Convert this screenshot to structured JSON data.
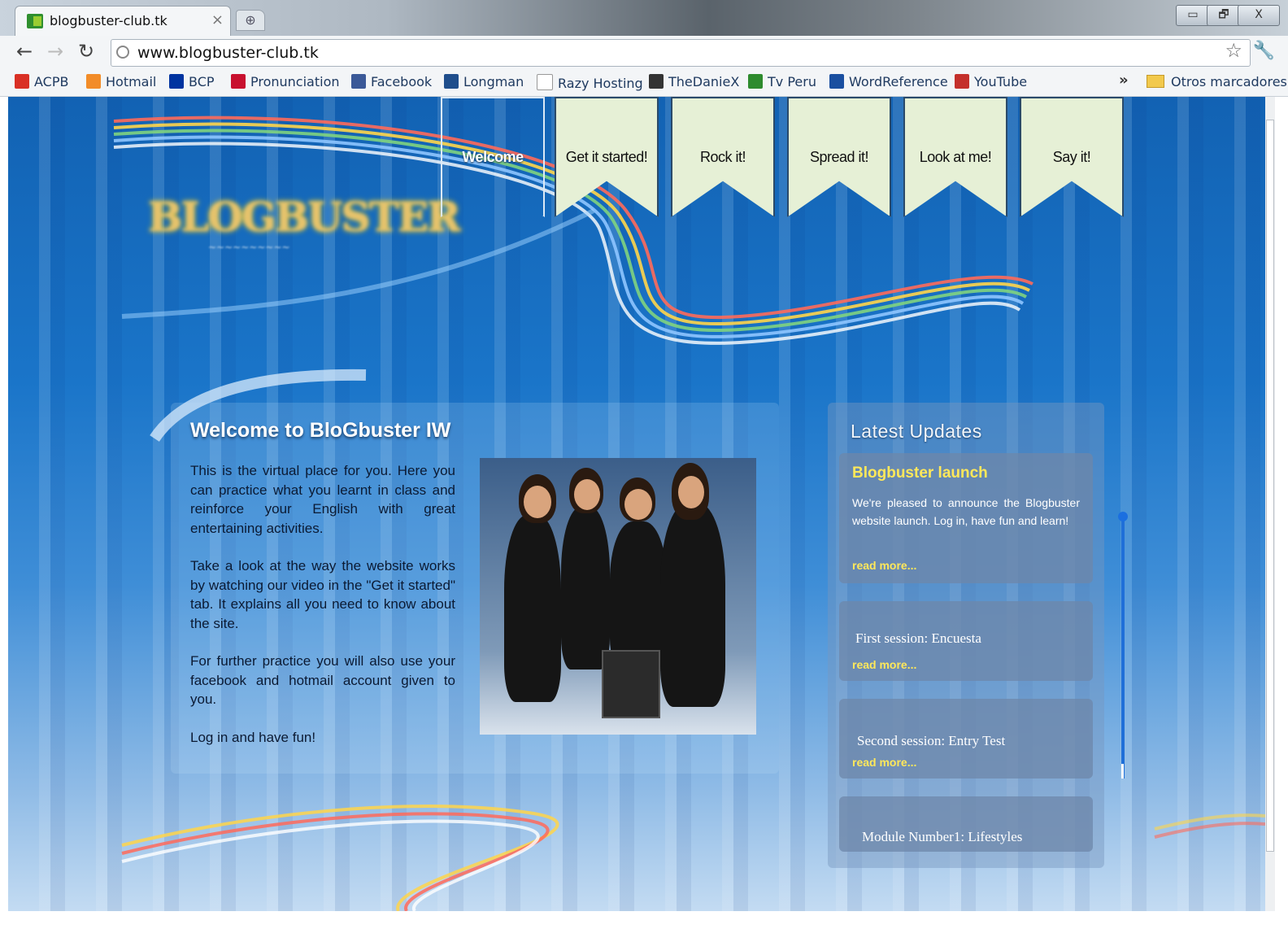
{
  "browser": {
    "tab_title": "blogbuster-club.tk",
    "tab_close": "×",
    "new_tab": "⊕",
    "window_controls": [
      "▭",
      "🗗",
      "X"
    ],
    "url": "www.blogbuster-club.tk",
    "bookmarks": [
      {
        "label": "ACPB",
        "icon": "gmail-icon",
        "color": "#d93025"
      },
      {
        "label": "Hotmail",
        "icon": "hotmail-icon",
        "color": "#f28c28"
      },
      {
        "label": "BCP",
        "icon": "bcp-icon",
        "color": "#0033a0"
      },
      {
        "label": "Pronunciation",
        "icon": "hj-icon",
        "color": "#c8102e"
      },
      {
        "label": "Facebook",
        "icon": "facebook-icon",
        "color": "#3b5998"
      },
      {
        "label": "Longman",
        "icon": "longman-icon",
        "color": "#1f4e8c"
      },
      {
        "label": "Razy Hosting",
        "icon": "page-icon",
        "color": "#ffffff"
      },
      {
        "label": "TheDanieX",
        "icon": "biohazard-icon",
        "color": "#333333"
      },
      {
        "label": "Tv Peru",
        "icon": "tvperu-icon",
        "color": "#2e8b2e"
      },
      {
        "label": "WordReference",
        "icon": "wordreference-icon",
        "color": "#1a4fa0"
      },
      {
        "label": "YouTube",
        "icon": "youtube-icon",
        "color": "#c4302b"
      }
    ],
    "bookmarks_overflow": "»",
    "other_bookmarks": "Otros marcadores"
  },
  "site": {
    "logo_text": "BLOGBUSTER",
    "nav": [
      {
        "label": "Welcome",
        "active": true
      },
      {
        "label": "Get it started!",
        "active": false
      },
      {
        "label": "Rock it!",
        "active": false
      },
      {
        "label": "Spread it!",
        "active": false
      },
      {
        "label": "Look at me!",
        "active": false
      },
      {
        "label": "Say it!",
        "active": false
      }
    ],
    "welcome": {
      "title": "Welcome to BloGbuster IW",
      "paragraphs": [
        "This is the virtual place for you. Here you can practice what you learnt in class and reinforce your English  with great entertaining activities.",
        "Take a look at the way the website works by watching our video in the \"Get it started\" tab. It explains all you need to know about the site.",
        "For further practice you will also use your facebook and hotmail account given to you.",
        "Log in and have fun!"
      ]
    },
    "updates": {
      "title": "Latest Updates",
      "items": [
        {
          "heading": "Blogbuster launch",
          "body": "We're pleased to announce the Blogbuster website launch. Log in, have fun and learn!",
          "more": "read more..."
        },
        {
          "heading": "First session: Encuesta",
          "more": "read more..."
        },
        {
          "heading": "Second session: Entry Test",
          "more": "read more..."
        },
        {
          "heading": "Module Number1: Lifestyles"
        }
      ]
    }
  },
  "colors": {
    "page_blue": "#1a75c9",
    "tab_cream": "#e6f0d6",
    "accent_yellow": "#ffe85a"
  }
}
